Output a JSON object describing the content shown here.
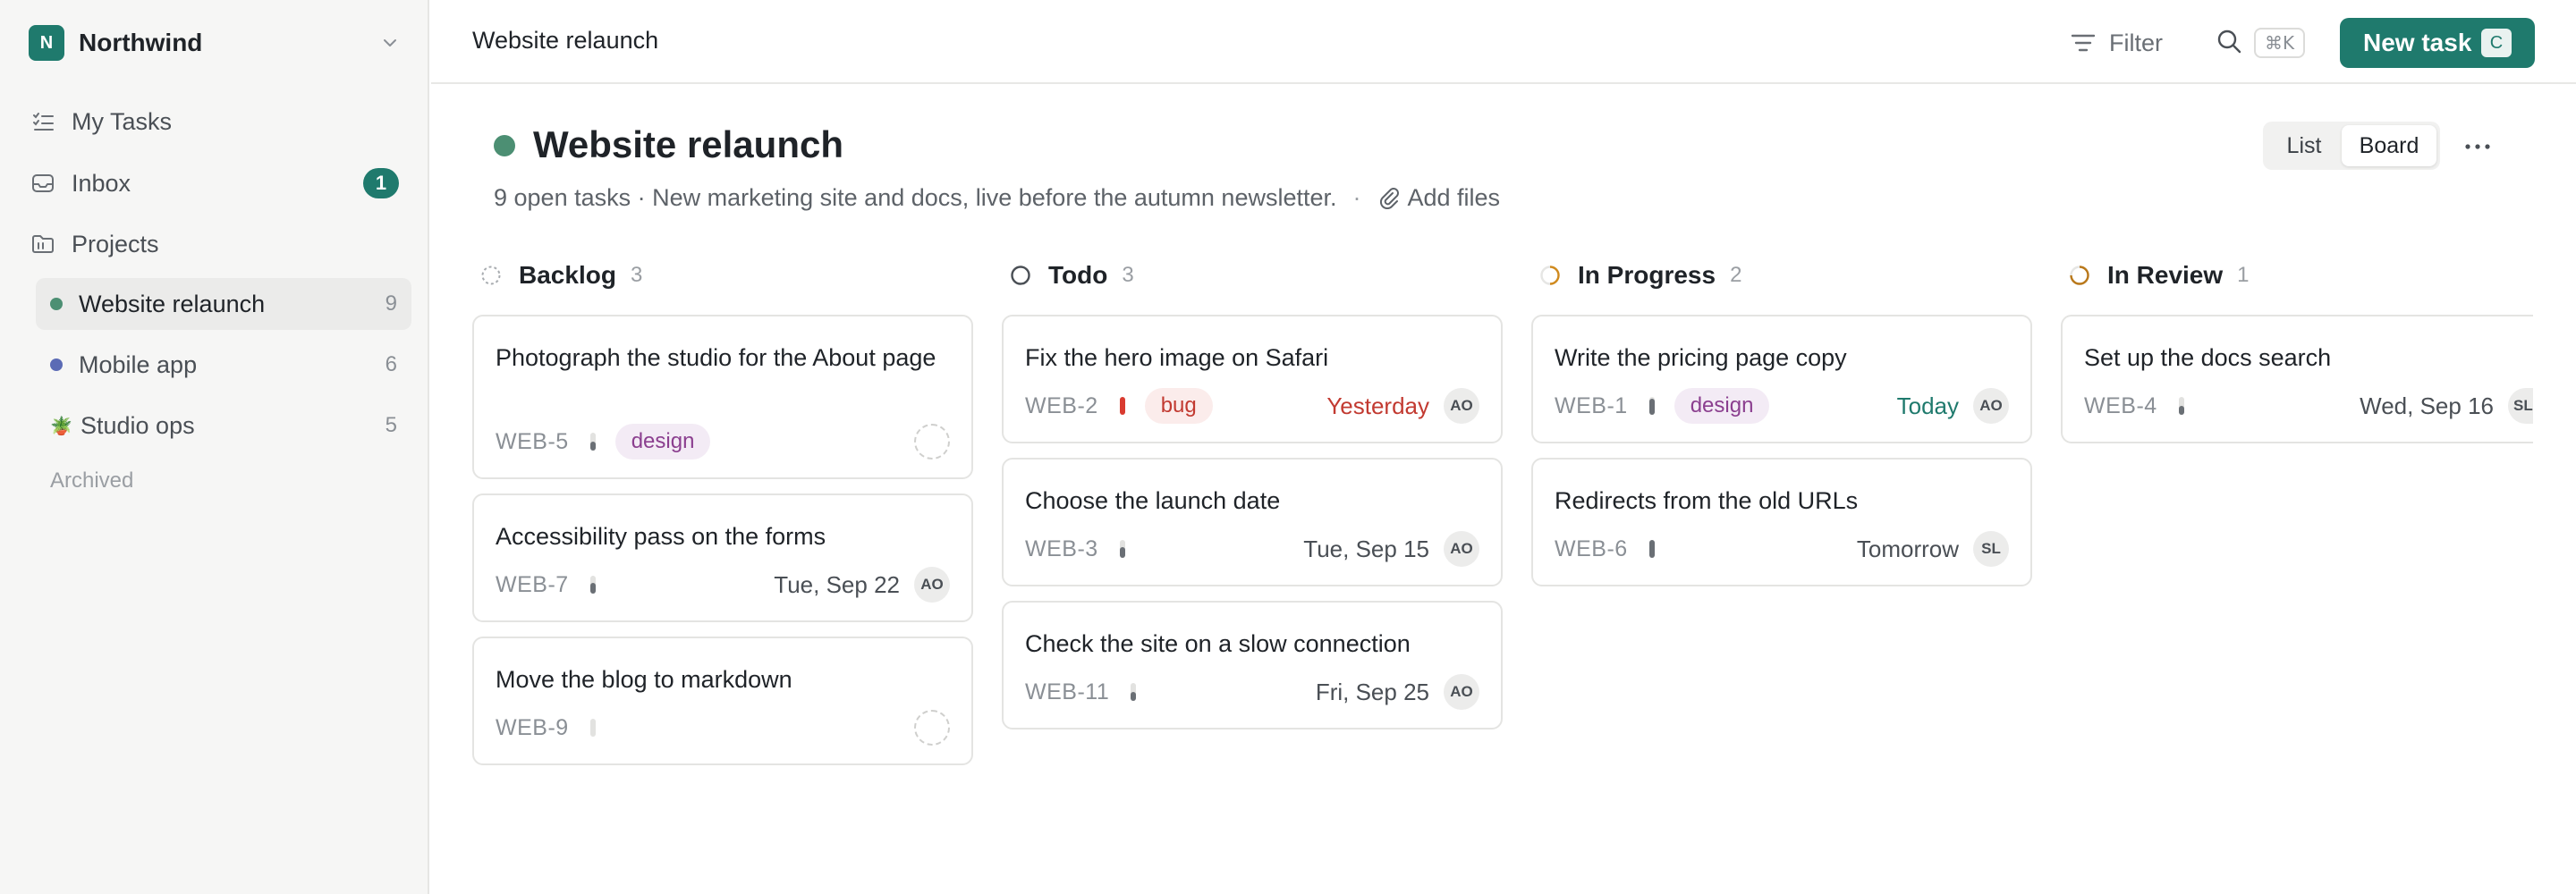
{
  "workspace": {
    "initial": "N",
    "name": "Northwind"
  },
  "nav": [
    {
      "label": "My Tasks",
      "icon": "checklist-icon"
    },
    {
      "label": "Inbox",
      "icon": "inbox-icon",
      "badge": "1"
    },
    {
      "label": "Projects",
      "icon": "folder-icon"
    }
  ],
  "projects": [
    {
      "name": "Website relaunch",
      "count": "9",
      "color": "#4c8f73",
      "active": true
    },
    {
      "name": "Mobile app",
      "count": "6",
      "color": "#5b6bb5"
    },
    {
      "name": "Studio ops",
      "count": "5",
      "emoji": "🪴"
    }
  ],
  "archived_label": "Archived",
  "topbar": {
    "breadcrumb": "Website relaunch",
    "filter_label": "Filter",
    "search_shortcut": "⌘K",
    "new_task_label": "New task",
    "new_task_shortcut": "C"
  },
  "header": {
    "title": "Website relaunch",
    "dot_color": "#4c8f73",
    "description": "9 open tasks · New marketing site and docs, live before the autumn newsletter.",
    "separator": "·",
    "add_files_label": "Add files",
    "views": [
      "List",
      "Board"
    ],
    "active_view": "Board"
  },
  "columns": [
    {
      "name": "Backlog",
      "count": "3",
      "status_icon": "backlog-dashed-circle-icon",
      "cards": [
        {
          "title": "Photograph the studio for the About page",
          "id": "WEB-5",
          "tags": [
            "design"
          ],
          "due": "",
          "assignee": ""
        },
        {
          "title": "Accessibility pass on the forms",
          "id": "WEB-7",
          "tags": [],
          "due": "Tue, Sep 22",
          "assignee": "AO"
        },
        {
          "title": "Move the blog to markdown",
          "id": "WEB-9",
          "tags": [],
          "due": "",
          "assignee": ""
        }
      ]
    },
    {
      "name": "Todo",
      "count": "3",
      "status_icon": "todo-circle-icon",
      "cards": [
        {
          "title": "Fix the hero image on Safari",
          "id": "WEB-2",
          "tags": [
            "bug"
          ],
          "due": "Yesterday",
          "assignee": "AO"
        },
        {
          "title": "Choose the launch date",
          "id": "WEB-3",
          "tags": [],
          "due": "Tue, Sep 15",
          "assignee": "AO"
        },
        {
          "title": "Check the site on a slow connection",
          "id": "WEB-11",
          "tags": [],
          "due": "Fri, Sep 25",
          "assignee": "AO"
        }
      ]
    },
    {
      "name": "In Progress",
      "count": "2",
      "status_icon": "in-progress-circle-icon",
      "cards": [
        {
          "title": "Write the pricing page copy",
          "id": "WEB-1",
          "tags": [
            "design"
          ],
          "due": "Today",
          "assignee": "AO"
        },
        {
          "title": "Redirects from the old URLs",
          "id": "WEB-6",
          "tags": [],
          "due": "Tomorrow",
          "assignee": "SL"
        }
      ]
    },
    {
      "name": "In Review",
      "count": "1",
      "status_icon": "in-review-circle-icon",
      "cards": [
        {
          "title": "Set up the docs search",
          "id": "WEB-4",
          "tags": [],
          "due": "Wed, Sep 16",
          "assignee": "SL"
        }
      ]
    }
  ],
  "colors": {
    "accent": "#1f7a6d",
    "overdue": "#c23a31",
    "design_tag": "#8b3f8f"
  }
}
